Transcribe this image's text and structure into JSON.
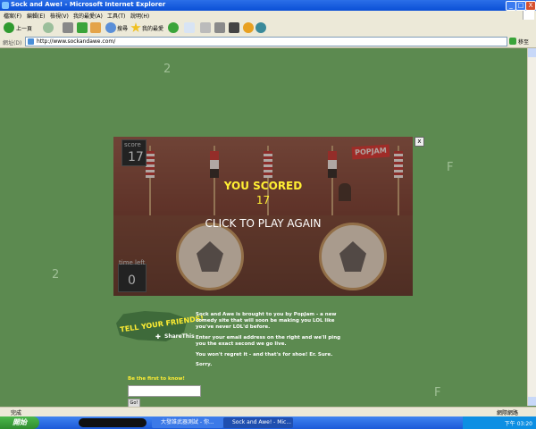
{
  "window": {
    "title": "Sock and Awe! - Microsoft Internet Explorer",
    "controls": {
      "minimize": "_",
      "maximize": "□",
      "close": "X"
    }
  },
  "menubar": {
    "items": [
      "檔案(F)",
      "編輯(E)",
      "檢視(V)",
      "我的最愛(A)",
      "工具(T)",
      "說明(H)"
    ]
  },
  "toolbar": {
    "back_label": "上一頁",
    "search_label": "搜尋",
    "favorites_label": "我的最愛"
  },
  "addressbar": {
    "label": "網址(D)",
    "url": "http://www.sockandawe.com/",
    "go_label": "移至"
  },
  "page": {
    "floating_marks": [
      "2",
      "2",
      "F",
      "F"
    ]
  },
  "game": {
    "score_label": "score",
    "score_value": "17",
    "time_label": "time left",
    "time_value": "0",
    "you_scored": "YOU SCORED",
    "final_score": "17",
    "click_again": "CLICK TO PLAY AGAIN",
    "sponsor": "POPJAM",
    "close": "x"
  },
  "promo": {
    "tell_friends": "TELL YOUR FRIENDS!",
    "share_label": "ShareThis",
    "para1": "Sock and Awe is brought to you by PopJam - a new comedy site that will soon be making you LOL like you've never LOL'd before.",
    "para2": "Enter your email address on the right and we'll ping you the exact second we go live.",
    "para3": "You won't regret it - and that's for shoe! Er. Sure.",
    "para4": "Sorry.",
    "first_to_know": "Be the first to know!",
    "go_button": "Go!"
  },
  "statusbar": {
    "status": "完成",
    "zone": "網際網路"
  },
  "taskbar": {
    "start": "開始",
    "task1": "大發誰武器測試 - 你...",
    "task2": "Sock and Awe! - Mic...",
    "clock": "下午 03:20"
  }
}
